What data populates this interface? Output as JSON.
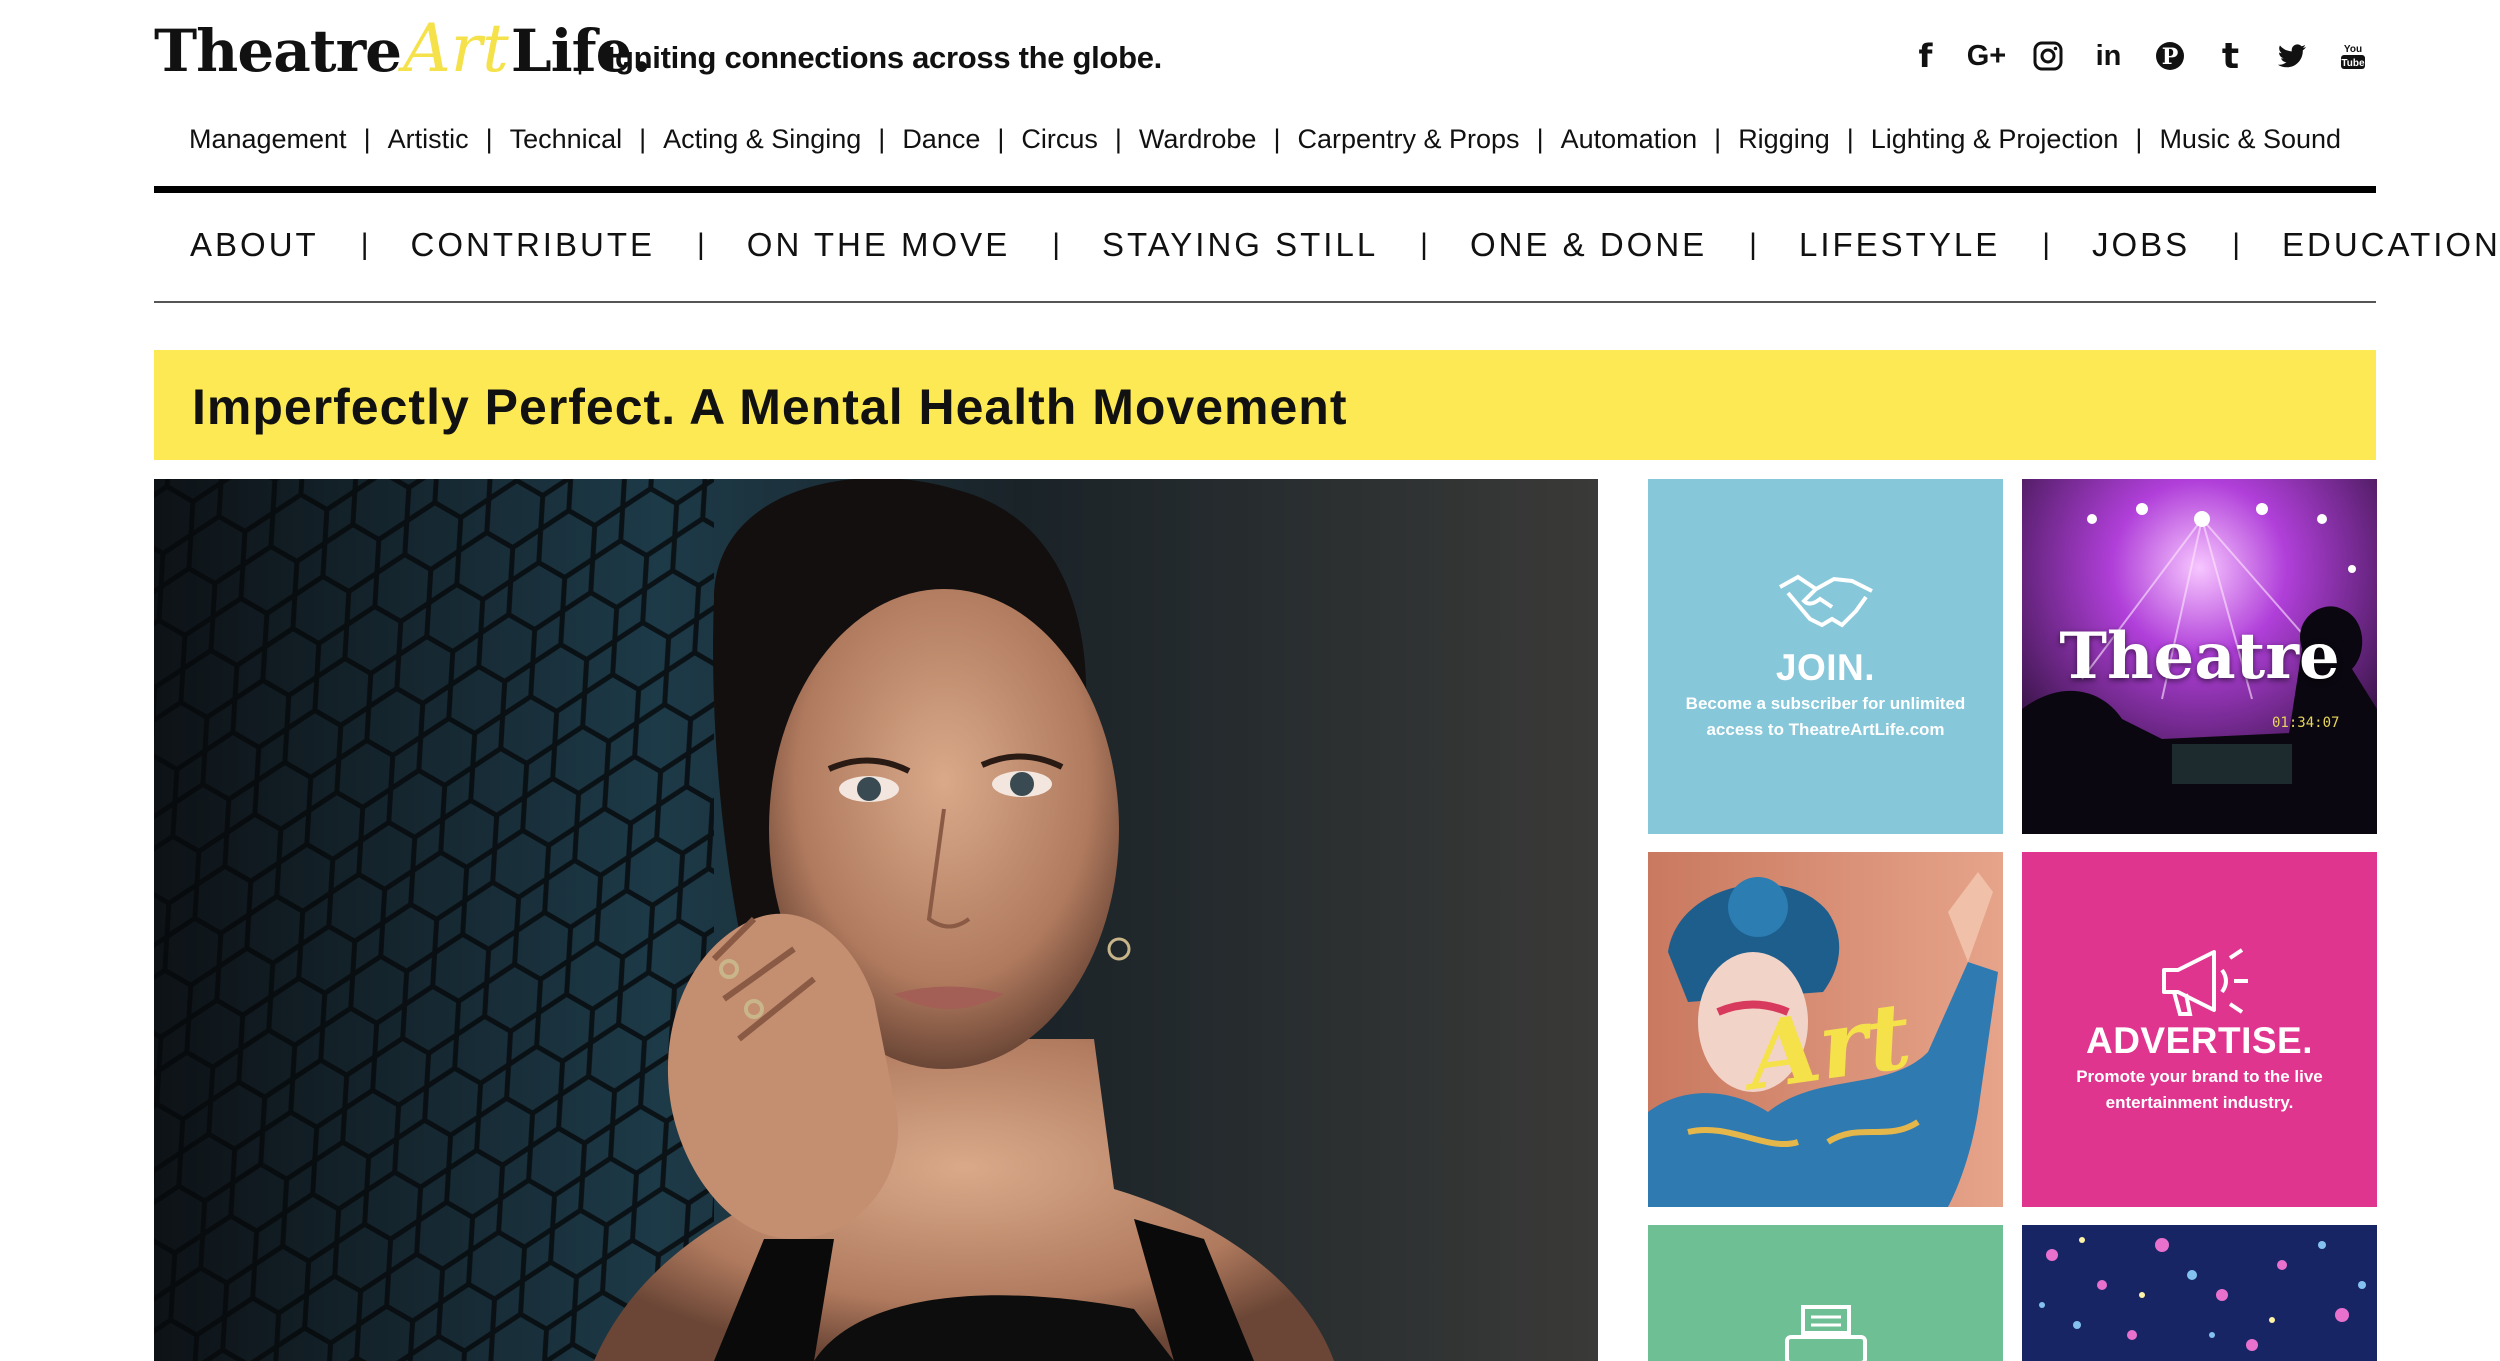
{
  "brand": {
    "logo_part1": "Theatre",
    "logo_part2": "Art",
    "logo_part3": "Life.",
    "separator": "|",
    "tagline": "Igniting connections across the globe.",
    "accent_color": "#fde954",
    "logo_art_color": "#f5e14a"
  },
  "social": [
    {
      "icon": "facebook-icon",
      "glyph": "f"
    },
    {
      "icon": "google-plus-icon",
      "glyph": "G+"
    },
    {
      "icon": "instagram-icon",
      "glyph": ""
    },
    {
      "icon": "linkedin-icon",
      "glyph": "in"
    },
    {
      "icon": "pinterest-icon",
      "glyph": "P"
    },
    {
      "icon": "tumblr-icon",
      "glyph": "t"
    },
    {
      "icon": "twitter-icon",
      "glyph": ""
    },
    {
      "icon": "youtube-icon",
      "glyph": "You Tube"
    }
  ],
  "category_nav": {
    "separator": "|",
    "items": [
      "Management",
      "Artistic",
      "Technical",
      "Acting & Singing",
      "Dance",
      "Circus",
      "Wardrobe",
      "Carpentry & Props",
      "Automation",
      "Rigging",
      "Lighting & Projection",
      "Music & Sound"
    ]
  },
  "main_nav": {
    "separator": "|",
    "items": [
      "ABOUT",
      "CONTRIBUTE",
      "ON THE MOVE",
      "STAYING STILL",
      "ONE & DONE",
      "LIFESTYLE",
      "JOBS",
      "EDUCATION"
    ]
  },
  "headline": "Imperfectly Perfect. A Mental Health Movement",
  "tiles": {
    "join": {
      "title": "JOIN.",
      "desc": "Become a subscriber for unlimited access to TheatreArtLife.com",
      "icon": "handshake-icon",
      "color": "#86c7d9"
    },
    "theatre": {
      "word": "Theatre"
    },
    "art": {
      "word": "Art"
    },
    "advertise": {
      "title": "ADVERTISE.",
      "desc": "Promote your brand to the live entertainment industry.",
      "icon": "megaphone-icon",
      "color": "#e0358f"
    },
    "green": {
      "icon": "typewriter-icon",
      "color": "#6fbf95"
    }
  }
}
